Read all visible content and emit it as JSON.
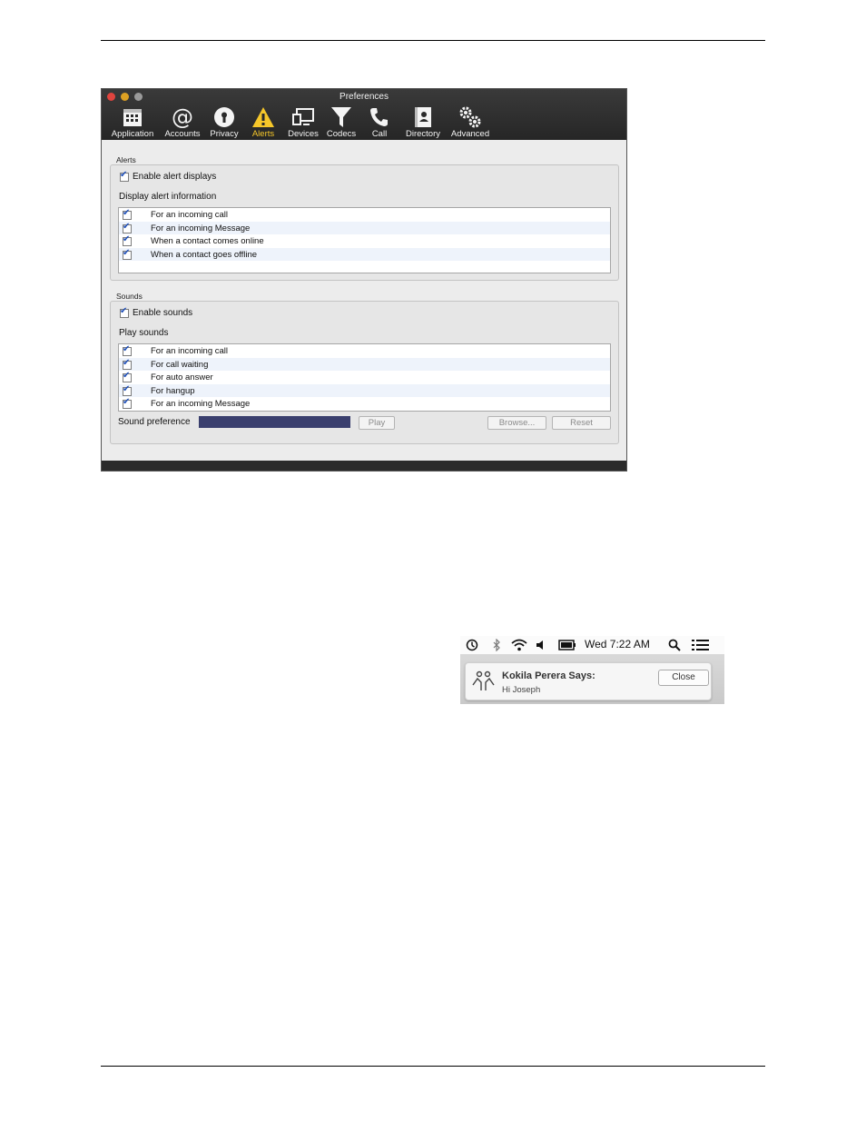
{
  "window": {
    "title": "Preferences",
    "toolbar": [
      {
        "label": "Application",
        "icon": "calendar-grid-icon"
      },
      {
        "label": "Accounts",
        "icon": "at-sign-icon"
      },
      {
        "label": "Privacy",
        "icon": "keyhole-icon"
      },
      {
        "label": "Alerts",
        "icon": "warning-triangle-icon",
        "active": true
      },
      {
        "label": "Devices",
        "icon": "monitor-icon"
      },
      {
        "label": "Codecs",
        "icon": "funnel-icon"
      },
      {
        "label": "Call",
        "icon": "phone-icon"
      },
      {
        "label": "Directory",
        "icon": "contact-book-icon"
      },
      {
        "label": "Advanced",
        "icon": "gears-icon"
      }
    ]
  },
  "alerts": {
    "section_title": "Alerts",
    "enable_label": "Enable alert displays",
    "enable_checked": true,
    "list_label": "Display alert information",
    "items": [
      {
        "label": "For an incoming call",
        "checked": true
      },
      {
        "label": "For an incoming Message",
        "checked": true
      },
      {
        "label": "When a contact comes online",
        "checked": true
      },
      {
        "label": "When a contact goes offline",
        "checked": true
      }
    ]
  },
  "sounds": {
    "section_title": "Sounds",
    "enable_label": "Enable sounds",
    "enable_checked": true,
    "list_label": "Play sounds",
    "items": [
      {
        "label": "For an incoming call",
        "checked": true
      },
      {
        "label": "For call waiting",
        "checked": true
      },
      {
        "label": "For auto answer",
        "checked": true
      },
      {
        "label": "For hangup",
        "checked": true
      },
      {
        "label": "For an incoming Message",
        "checked": true
      }
    ],
    "preference_label": "Sound preference",
    "play_label": "Play",
    "browse_label": "Browse...",
    "reset_label": "Reset"
  },
  "menubar": {
    "clock": "Wed 7:22 AM"
  },
  "notification": {
    "sender": "Kokila Perera Says:",
    "message": "Hi Joseph",
    "close_label": "Close"
  },
  "colors": {
    "accent_active": "#f6c72a",
    "checkmark": "#1f4fb8",
    "sound_field": "#3a3f6e"
  }
}
